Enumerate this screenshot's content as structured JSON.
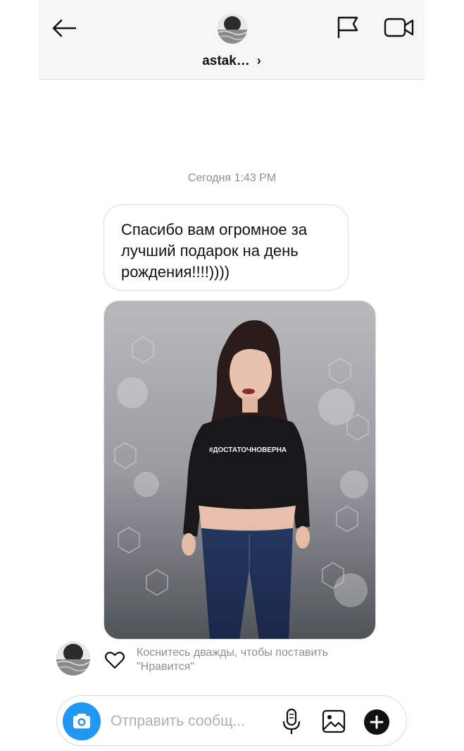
{
  "header": {
    "username": "astak…",
    "chevron": "›",
    "icons": {
      "back": "arrow-left-icon",
      "flag": "flag-icon",
      "video": "video-camera-icon"
    }
  },
  "chat": {
    "timestamp": "Сегодня 1:43 PM",
    "message_text": "Спасибо вам огромное за лучший подарок на день рождения!!!!))))",
    "photo_shirt_text": "#ДОСТАТОЧНОВЕРНА",
    "like_hint": "Коснитесь дважды, чтобы поставить \"Нравится\""
  },
  "composer": {
    "placeholder": "Отправить сообщ...",
    "icons": {
      "camera": "camera-icon",
      "mic": "microphone-icon",
      "gallery": "gallery-icon",
      "plus": "plus-icon"
    }
  },
  "colors": {
    "accent_blue": "#2296f3",
    "muted_text": "#8e8e8e",
    "header_bg": "#f6f6f6"
  }
}
